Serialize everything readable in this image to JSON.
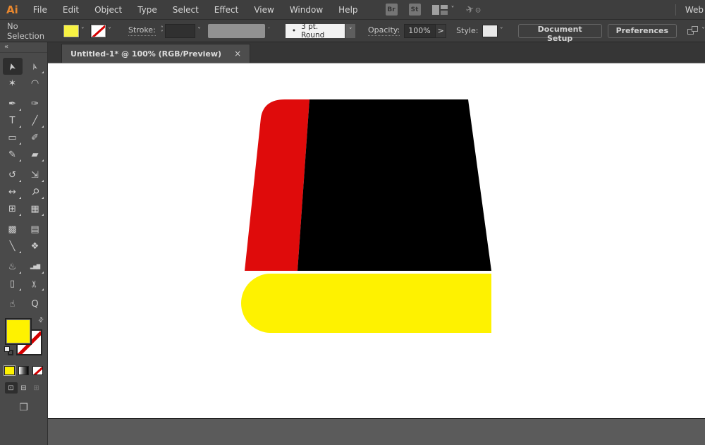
{
  "menubar": {
    "logo": "Ai",
    "menus": [
      "File",
      "Edit",
      "Object",
      "Type",
      "Select",
      "Effect",
      "View",
      "Window",
      "Help"
    ],
    "bridge_button": "Br",
    "stock_button": "St",
    "workspace_label": "Web"
  },
  "controlbar": {
    "selection_status": "No Selection",
    "stroke_label": "Stroke:",
    "brush_bullet": "•",
    "brush_value": "3 pt. Round",
    "opacity_label": "Opacity:",
    "opacity_value": "100%",
    "opacity_more": ">",
    "style_label": "Style:",
    "document_setup_button": "Document Setup",
    "preferences_button": "Preferences"
  },
  "tabbar": {
    "title": "Untitled-1* @ 100% (RGB/Preview)",
    "close_glyph": "×"
  },
  "toolbar": {
    "collapse_glyph": "«",
    "tools": [
      {
        "name": "selection",
        "label": "Selection Tool",
        "glyph": "➤",
        "rot": -105,
        "active": true
      },
      {
        "name": "direct-selection",
        "label": "Direct Selection Tool",
        "glyph": "➢",
        "rot": -105,
        "badge": true
      },
      {
        "name": "magic-wand",
        "label": "Magic Wand Tool",
        "glyph": "✶"
      },
      {
        "name": "lasso",
        "label": "Lasso Tool",
        "glyph": "◠",
        "gap_after": true
      },
      {
        "name": "pen",
        "label": "Pen Tool",
        "glyph": "✒",
        "badge": true
      },
      {
        "name": "curvature",
        "label": "Curvature Tool",
        "glyph": "✑"
      },
      {
        "name": "type",
        "label": "Type Tool",
        "glyph": "T",
        "badge": true
      },
      {
        "name": "line-segment",
        "label": "Line Segment Tool",
        "glyph": "╱",
        "badge": true
      },
      {
        "name": "rectangle",
        "label": "Rectangle Tool",
        "glyph": "▭",
        "badge": true
      },
      {
        "name": "paintbrush",
        "label": "Paintbrush Tool",
        "glyph": "✐"
      },
      {
        "name": "shaper",
        "label": "Shaper Tool",
        "glyph": "✎",
        "badge": true
      },
      {
        "name": "eraser",
        "label": "Eraser Tool",
        "glyph": "▰",
        "badge": true,
        "gap_after": true
      },
      {
        "name": "rotate",
        "label": "Rotate Tool",
        "glyph": "↺",
        "badge": true
      },
      {
        "name": "scale",
        "label": "Scale Tool",
        "glyph": "⇲",
        "badge": true
      },
      {
        "name": "width",
        "label": "Width Tool",
        "glyph": "↔",
        "badge": true
      },
      {
        "name": "puppet-warp",
        "label": "Puppet Warp Tool",
        "glyph": "⚲",
        "rot": 45,
        "badge": true
      },
      {
        "name": "shape-builder",
        "label": "Shape Builder Tool",
        "glyph": "⊞",
        "badge": true
      },
      {
        "name": "perspective-grid",
        "label": "Perspective Grid Tool",
        "glyph": "▦",
        "badge": true,
        "gap_after": true
      },
      {
        "name": "mesh",
        "label": "Mesh Tool",
        "glyph": "▩"
      },
      {
        "name": "gradient",
        "label": "Gradient Tool",
        "glyph": "▤"
      },
      {
        "name": "eyedropper",
        "label": "Eyedropper Tool",
        "glyph": "╲",
        "badge": true
      },
      {
        "name": "blend",
        "label": "Blend Tool",
        "glyph": "❖",
        "gap_after": true
      },
      {
        "name": "symbol-sprayer",
        "label": "Symbol Sprayer Tool",
        "glyph": "♨",
        "badge": true
      },
      {
        "name": "column-graph",
        "label": "Column Graph Tool",
        "glyph": "▂▅▇",
        "badge": true
      },
      {
        "name": "artboard",
        "label": "Artboard Tool",
        "glyph": "▯",
        "badge": true
      },
      {
        "name": "slice",
        "label": "Slice Tool",
        "glyph": "✂",
        "rot": -90,
        "badge": true,
        "gap_after": true
      },
      {
        "name": "hand",
        "label": "Hand Tool",
        "glyph": "☝"
      },
      {
        "name": "zoom",
        "label": "Zoom Tool",
        "glyph": "Q"
      }
    ]
  },
  "colors": {
    "logo_orange": "#E8872E",
    "swatch_yellow": "#F7F243",
    "artboard_white": "#FFFFFF",
    "pasteboard_gray": "#5B5B5B"
  },
  "artwork": {
    "spine_color": "#DF0B0B",
    "cover_color": "#000000",
    "pages_color": "#FEF200"
  }
}
